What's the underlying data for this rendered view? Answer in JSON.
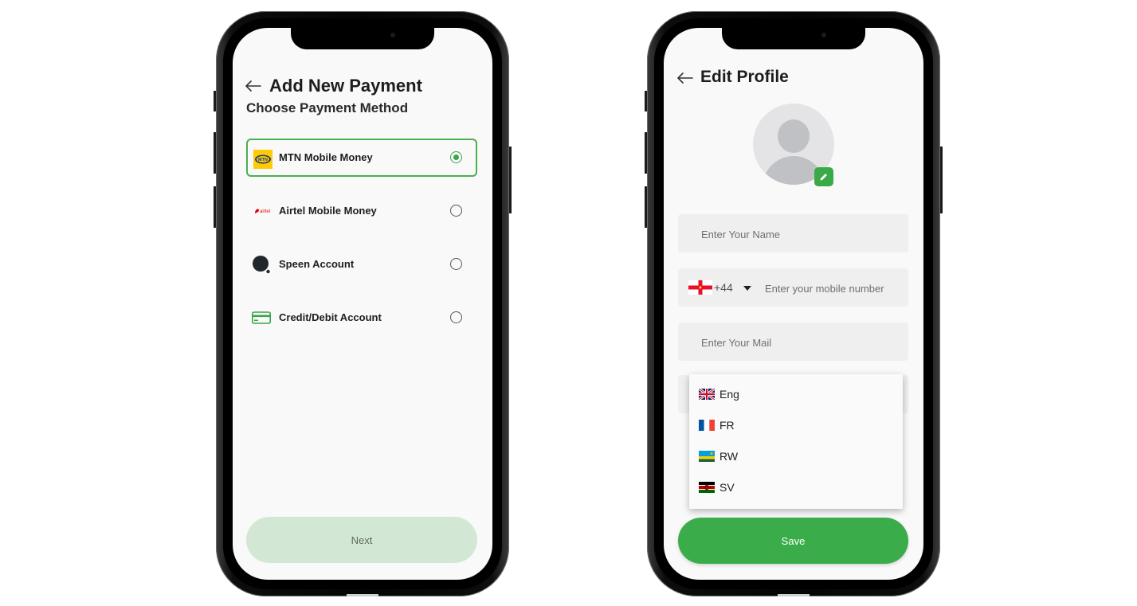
{
  "payment_screen": {
    "title": "Add New Payment",
    "section_label": "Choose Payment Method",
    "methods": [
      {
        "label": "MTN Mobile Money",
        "icon": "mtn-logo-icon",
        "selected": true
      },
      {
        "label": "Airtel Mobile Money",
        "icon": "airtel-logo-icon",
        "selected": false
      },
      {
        "label": "Speen Account",
        "icon": "speen-logo-icon",
        "selected": false
      },
      {
        "label": "Credit/Debit Account",
        "icon": "credit-card-icon",
        "selected": false
      }
    ],
    "next_label": "Next"
  },
  "profile_screen": {
    "title": "Edit Profile",
    "name_placeholder": "Enter Your Name",
    "phone_country_code": "+44",
    "phone_placeholder": "Enter your mobile number",
    "mail_placeholder": "Enter Your Mail",
    "language_options": [
      {
        "label": "Eng",
        "flag": "uk-flag-icon"
      },
      {
        "label": "FR",
        "flag": "france-flag-icon"
      },
      {
        "label": "RW",
        "flag": "rwanda-flag-icon"
      },
      {
        "label": "SV",
        "flag": "kenya-flag-icon"
      }
    ],
    "save_label": "Save"
  },
  "colors": {
    "accent_green": "#3aad4a",
    "disabled_green": "#d3e8d4",
    "field_bg": "#efefef"
  }
}
